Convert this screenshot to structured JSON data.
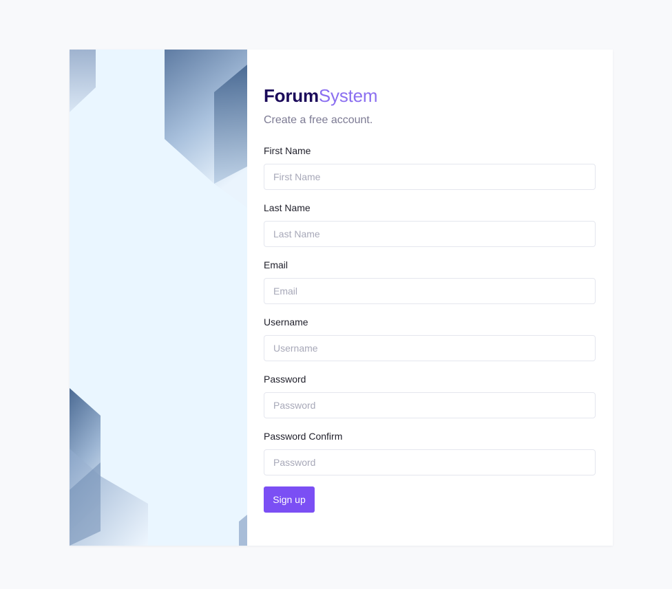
{
  "brand": {
    "part1": "Forum",
    "part2": "System"
  },
  "subtitle": "Create a free account.",
  "fields": [
    {
      "label": "First Name",
      "placeholder": "First Name",
      "value": ""
    },
    {
      "label": "Last Name",
      "placeholder": "Last Name",
      "value": ""
    },
    {
      "label": "Email",
      "placeholder": "Email",
      "value": ""
    },
    {
      "label": "Username",
      "placeholder": "Username",
      "value": ""
    },
    {
      "label": "Password",
      "placeholder": "Password",
      "value": ""
    },
    {
      "label": "Password Confirm",
      "placeholder": "Password",
      "value": ""
    }
  ],
  "submit_label": "Sign up",
  "colors": {
    "page_bg": "#f8f9fb",
    "brand_dark": "#1b0a5a",
    "brand_accent": "#8b6ff0",
    "button": "#7b4ff4",
    "art_bg": "#eaf6ff"
  }
}
